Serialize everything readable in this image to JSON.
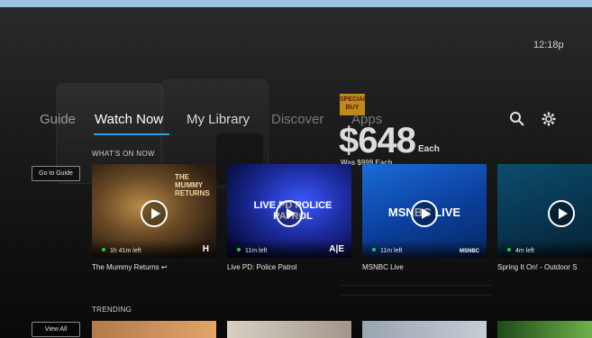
{
  "clock": "12:18p",
  "nav": {
    "items": [
      {
        "label": "Guide",
        "active": false
      },
      {
        "label": "Watch Now",
        "active": true
      },
      {
        "label": "My Library",
        "active": false
      },
      {
        "label": "Discover",
        "active": false
      },
      {
        "label": "Apps",
        "active": false
      }
    ],
    "icons": [
      "search-icon",
      "gear-icon"
    ]
  },
  "ad": {
    "badge": "SPECIAL BUY",
    "price": "$648",
    "price_suffix": "Each",
    "was": "Was $999 Each"
  },
  "sections": {
    "on_now": {
      "label": "WHAT'S ON NOW",
      "side_button": "Go to Guide",
      "tiles": [
        {
          "title": "The Mummy Returns",
          "time_left": "1h 41m left",
          "network": "H",
          "art_text": "THE MUMMY RETURNS",
          "status_color": "#26c94b"
        },
        {
          "title": "Live PD: Police Patrol",
          "time_left": "11m left",
          "network": "A|E",
          "art_text": "LIVE PD POLICE PATROL",
          "status_color": "#26c94b"
        },
        {
          "title": "MSNBC Live",
          "time_left": "11m left",
          "network": "MSNBC",
          "art_text": "MSNBC LIVE",
          "status_color": "#26c94b"
        },
        {
          "title": "Spring It On! - Outdoor S",
          "time_left": "4m left",
          "network": "",
          "art_text": "",
          "status_color": "#26c94b"
        }
      ]
    },
    "trending": {
      "label": "TRENDING",
      "side_button": "View All"
    }
  },
  "colors": {
    "accent": "#2aa0e6",
    "live_dot": "#26c94b",
    "top_bar": "#9cc3e0"
  }
}
